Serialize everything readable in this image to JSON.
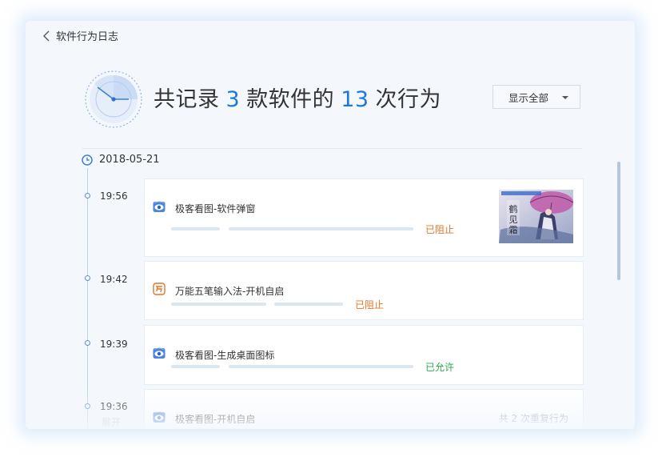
{
  "header": {
    "back_label": "软件行为日志"
  },
  "summary": {
    "prefix": "共记录",
    "software_count": "3",
    "middle": "款软件的",
    "behavior_count": "13",
    "suffix": "次行为"
  },
  "filter": {
    "selected": "显示全部"
  },
  "timeline": {
    "date": "2018-05-21",
    "entries": [
      {
        "time": "19:56",
        "title": "极客看图-软件弹窗",
        "status": "已阻止",
        "icon": "eye-icon"
      },
      {
        "time": "19:42",
        "title": "万能五笔输入法-开机自启",
        "status": "已阻止",
        "icon": "wubi-icon"
      },
      {
        "time": "19:39",
        "title": "极客看图-生成桌面图标",
        "status": "已允许",
        "icon": "eye-icon"
      },
      {
        "time": "19:36",
        "sub": "展开",
        "title": "极客看图-开机自启",
        "repeat": "共 2 次重复行为",
        "icon": "eye-icon"
      }
    ]
  },
  "colors": {
    "accent": "#1a78e0",
    "blocked": "#e0782a",
    "allowed": "#2aa84e"
  }
}
